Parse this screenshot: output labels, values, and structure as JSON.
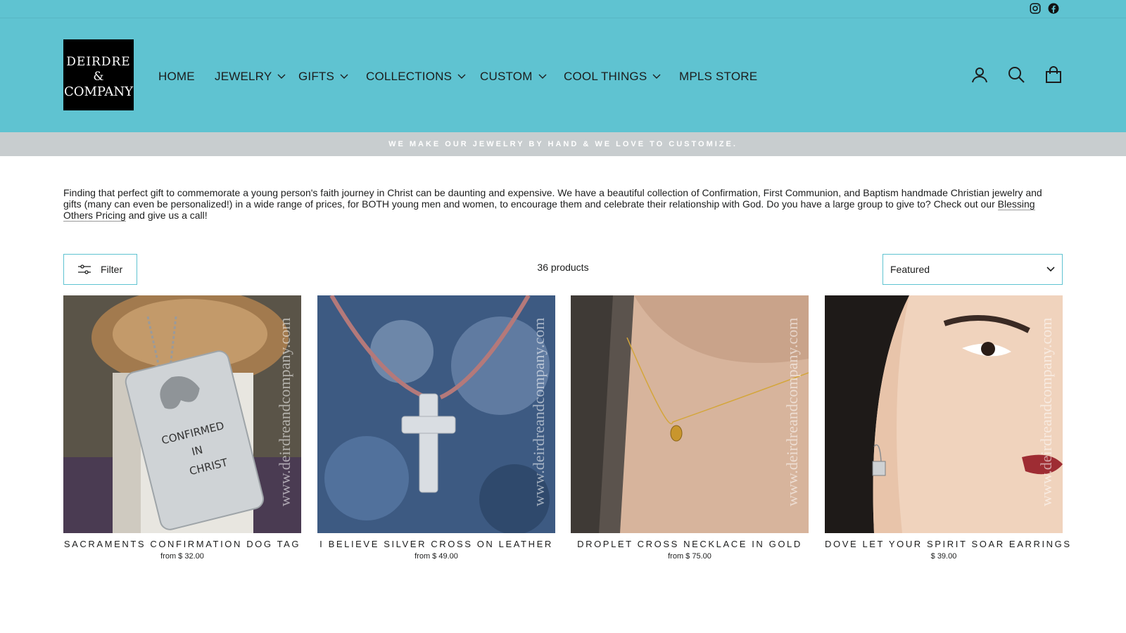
{
  "topbar": {
    "social": [
      "instagram-icon",
      "facebook-icon"
    ]
  },
  "header": {
    "logo": {
      "line1": "DEIRDRE",
      "line2": "&",
      "line3": "COMPANY"
    },
    "nav": [
      {
        "label": "HOME",
        "dropdown": false
      },
      {
        "label": "JEWELRY",
        "dropdown": true
      },
      {
        "label": "GIFTS",
        "dropdown": true
      },
      {
        "label": "COLLECTIONS",
        "dropdown": true
      },
      {
        "label": "CUSTOM",
        "dropdown": true
      },
      {
        "label": "COOL THINGS",
        "dropdown": true
      },
      {
        "label": "MPLS STORE",
        "dropdown": false
      }
    ],
    "icons": [
      "account-icon",
      "search-icon",
      "cart-icon"
    ]
  },
  "announcement": "WE MAKE OUR JEWELRY BY HAND & WE LOVE TO CUSTOMIZE.",
  "intro": {
    "text": "Finding that perfect gift to commemorate a young person's faith journey in Christ can be daunting and expensive.  We have a beautiful collection of Confirmation, First Communion, and Baptism handmade Christian jewelry and gifts (many can even be personalized!) in a wide range of prices, for BOTH young men and women, to encourage them and celebrate their relationship with God.  Do you have a large group to give to?  Check out our ",
    "link": "Blessing Others Pricing",
    "tail": " and give us a call!"
  },
  "toolbar": {
    "filter_label": "Filter",
    "count": "36 products",
    "sort_value": "Featured"
  },
  "products": [
    {
      "title": "SACRAMENTS CONFIRMATION DOG TAG",
      "price": "from $ 32.00",
      "watermark": "www.deirdreandcompany.com",
      "tag_text": [
        "CONFIRMED",
        "IN",
        "CHRIST"
      ]
    },
    {
      "title": "I BELIEVE SILVER CROSS ON LEATHER",
      "price": "from $ 49.00",
      "watermark": "www.deirdreandcompany.com"
    },
    {
      "title": "DROPLET CROSS NECKLACE IN GOLD",
      "price": "from $ 75.00",
      "watermark": "www.deirdreandcompany.com"
    },
    {
      "title": "DOVE LET YOUR SPIRIT SOAR EARRINGS",
      "price": "$ 39.00",
      "watermark": "www.deirdreandcompany.com"
    }
  ],
  "colors": {
    "header_bg": "#5fc3d1",
    "announce_bg": "#c8cdcf",
    "accent_border": "#5fc3d1"
  }
}
